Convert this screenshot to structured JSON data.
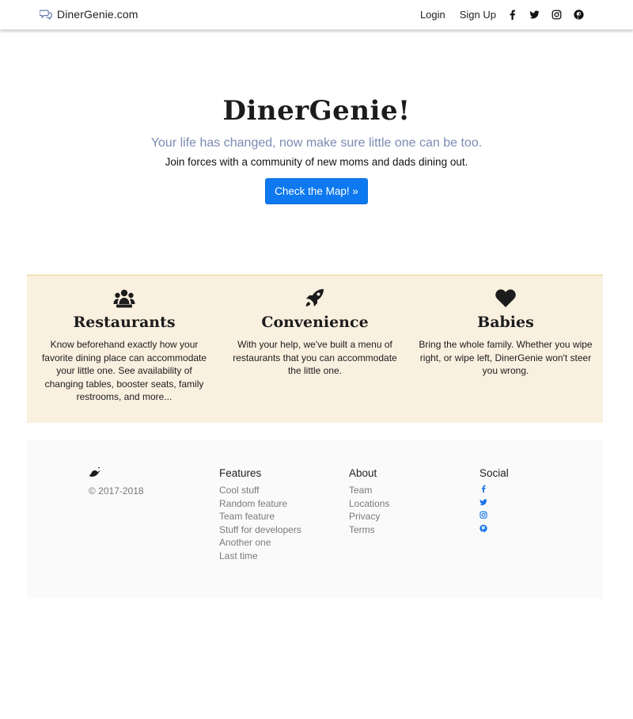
{
  "navbar": {
    "brand": "DinerGenie.com",
    "login": "Login",
    "signup": "Sign Up",
    "social_icons": [
      "facebook-icon",
      "twitter-icon",
      "instagram-icon",
      "pinterest-icon"
    ]
  },
  "hero": {
    "title": "DinerGenie!",
    "subtitle": "Your life has changed, now make sure little one can be too.",
    "lead": "Join forces with a community of new moms and dads dining out.",
    "button": "Check the Map! »"
  },
  "features": [
    {
      "icon": "users-icon",
      "title": "Restaurants",
      "text": "Know beforehand exactly how your favorite dining place can accommodate your little one. See availability of changing tables, booster seats, family restrooms, and more..."
    },
    {
      "icon": "rocket-icon",
      "title": "Convenience",
      "text": "With your help, we've built a menu of restaurants that you can accommodate the little one."
    },
    {
      "icon": "heart-icon",
      "title": "Babies",
      "text": "Bring the whole family. Whether you wipe right, or wipe left, DinerGenie won't steer you wrong."
    }
  ],
  "footer": {
    "copyright": "© 2017-2018",
    "columns": {
      "features": {
        "heading": "Features",
        "links": [
          "Cool stuff",
          "Random feature",
          "Team feature",
          "Stuff for developers",
          "Another one",
          "Last time"
        ]
      },
      "about": {
        "heading": "About",
        "links": [
          "Team",
          "Locations",
          "Privacy",
          "Terms"
        ]
      },
      "social": {
        "heading": "Social",
        "icons": [
          "facebook-icon",
          "twitter-icon",
          "instagram-icon",
          "pinterest-icon"
        ]
      }
    }
  },
  "colors": {
    "accent": "#0d78ef",
    "social_blue": "#1a73e8",
    "subtitle": "#7b8bb2",
    "feature_bg": "#faf0e0",
    "footer_bg": "#fafafa"
  }
}
